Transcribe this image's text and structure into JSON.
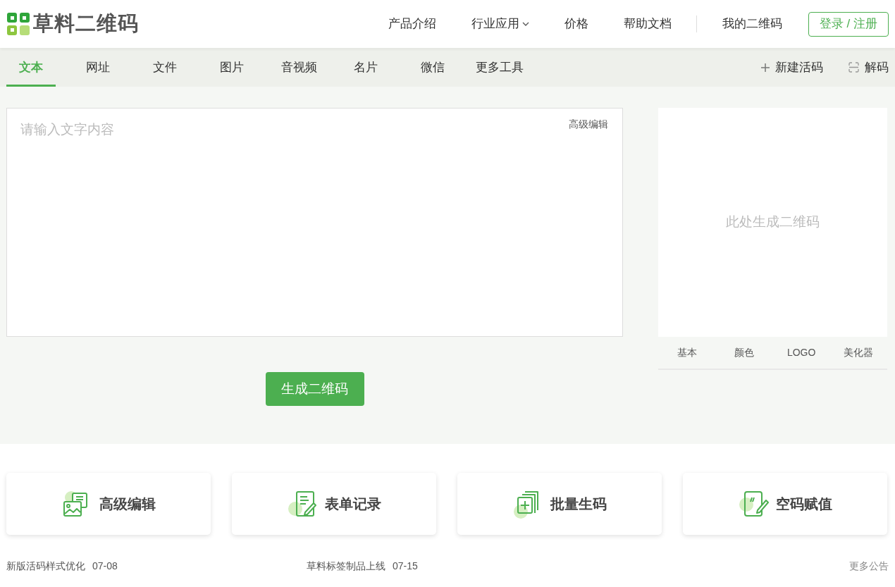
{
  "header": {
    "logo_text": "草料二维码",
    "nav": [
      {
        "label": "产品介绍",
        "has_menu": false
      },
      {
        "label": "行业应用",
        "has_menu": true
      },
      {
        "label": "价格",
        "has_menu": false
      },
      {
        "label": "帮助文档",
        "has_menu": false
      }
    ],
    "my_codes": "我的二维码",
    "login_button": "登录 / 注册"
  },
  "tabs": [
    {
      "label": "文本",
      "selected": true
    },
    {
      "label": "网址",
      "selected": false
    },
    {
      "label": "文件",
      "selected": false
    },
    {
      "label": "图片",
      "selected": false
    },
    {
      "label": "音视频",
      "selected": false
    },
    {
      "label": "名片",
      "selected": false
    },
    {
      "label": "微信",
      "selected": false
    },
    {
      "label": "更多工具",
      "selected": false
    }
  ],
  "tab_actions": [
    {
      "kind": "new",
      "label": "新建活码"
    },
    {
      "kind": "decode",
      "label": "解码"
    }
  ],
  "editor": {
    "placeholder": "请输入文字内容",
    "advanced_link": "高级编辑"
  },
  "generate_button": "生成二维码",
  "qr_preview": {
    "placeholder": "此处生成二维码",
    "style_tabs": [
      "基本",
      "颜色",
      "LOGO",
      "美化器"
    ]
  },
  "features": [
    {
      "kind": "edit",
      "label": "高级编辑"
    },
    {
      "kind": "form",
      "label": "表单记录"
    },
    {
      "kind": "batch",
      "label": "批量生码"
    },
    {
      "kind": "assign",
      "label": "空码赋值"
    }
  ],
  "notices": [
    {
      "title": "新版活码样式优化",
      "date": "07-08"
    },
    {
      "title": "草料标签制品上线",
      "date": "07-15"
    }
  ],
  "more_notices": "更多公告"
}
